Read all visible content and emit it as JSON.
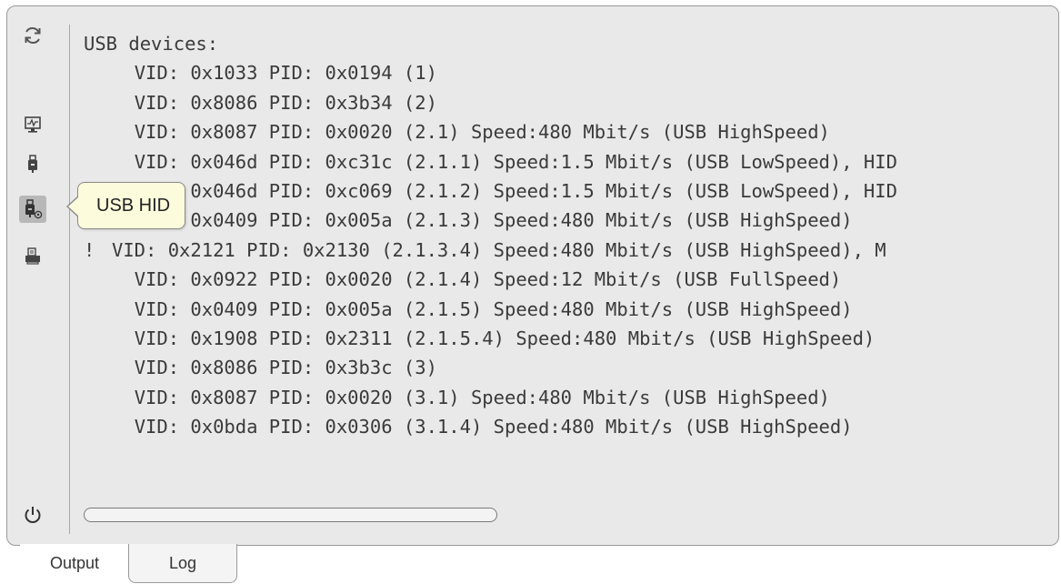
{
  "toolbar": {
    "refresh_icon": "refresh-icon",
    "monitor_icon": "monitor-icon",
    "usb_icon": "usb-icon",
    "usb_hid_icon": "usb-hid-icon",
    "printer_icon": "printer-icon",
    "power_icon": "power-icon"
  },
  "tooltip": {
    "text": "USB HID"
  },
  "output": {
    "lines": [
      {
        "mark": "",
        "indent": "",
        "text": "USB devices:"
      },
      {
        "mark": "",
        "indent": "  ",
        "text": "VID: 0x1033 PID: 0x0194 (1)"
      },
      {
        "mark": "",
        "indent": "  ",
        "text": "VID: 0x8086 PID: 0x3b34 (2)"
      },
      {
        "mark": "",
        "indent": "  ",
        "text": "VID: 0x8087 PID: 0x0020 (2.1) Speed:480 Mbit/s (USB HighSpeed)"
      },
      {
        "mark": "",
        "indent": "  ",
        "text": "VID: 0x046d PID: 0xc31c (2.1.1) Speed:1.5 Mbit/s (USB LowSpeed), HID"
      },
      {
        "mark": "",
        "indent": "  ",
        "text": "VID: 0x046d PID: 0xc069 (2.1.2) Speed:1.5 Mbit/s (USB LowSpeed), HID"
      },
      {
        "mark": "",
        "indent": "  ",
        "text": "VID: 0x0409 PID: 0x005a (2.1.3) Speed:480 Mbit/s (USB HighSpeed)"
      },
      {
        "mark": "!",
        "indent": "",
        "text": "VID: 0x2121 PID: 0x2130 (2.1.3.4) Speed:480 Mbit/s (USB HighSpeed), M"
      },
      {
        "mark": "",
        "indent": "  ",
        "text": "VID: 0x0922 PID: 0x0020 (2.1.4) Speed:12 Mbit/s (USB FullSpeed)"
      },
      {
        "mark": "",
        "indent": "  ",
        "text": "VID: 0x0409 PID: 0x005a (2.1.5) Speed:480 Mbit/s (USB HighSpeed)"
      },
      {
        "mark": "",
        "indent": "  ",
        "text": "VID: 0x1908 PID: 0x2311 (2.1.5.4) Speed:480 Mbit/s (USB HighSpeed)"
      },
      {
        "mark": "",
        "indent": "  ",
        "text": "VID: 0x8086 PID: 0x3b3c (3)"
      },
      {
        "mark": "",
        "indent": "  ",
        "text": "VID: 0x8087 PID: 0x0020 (3.1) Speed:480 Mbit/s (USB HighSpeed)"
      },
      {
        "mark": "",
        "indent": "  ",
        "text": "VID: 0x0bda PID: 0x0306 (3.1.4) Speed:480 Mbit/s (USB HighSpeed)"
      }
    ]
  },
  "progress": {
    "value": 0
  },
  "tabs": [
    {
      "label": "Output",
      "active": true
    },
    {
      "label": "Log",
      "active": false
    }
  ]
}
